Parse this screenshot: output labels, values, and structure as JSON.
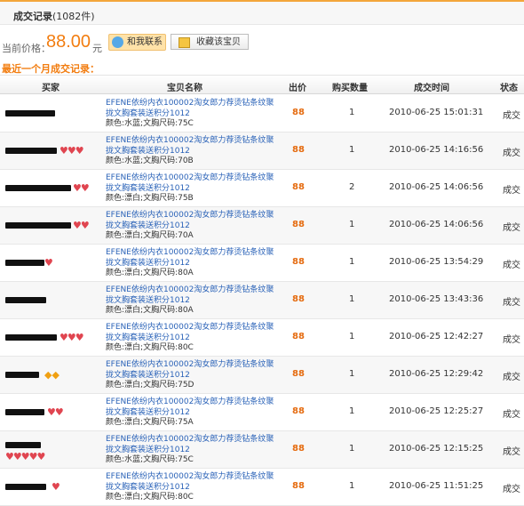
{
  "header": {
    "title": "成交记录",
    "count": "(1082件)"
  },
  "price": {
    "label": "当前价格：",
    "value": "88.00",
    "unit": "元"
  },
  "buttons": {
    "contact": "和我联系",
    "favorite": "收藏该宝贝"
  },
  "recent_title": "最近一个月成交记录：",
  "columns": {
    "buyer": "买家",
    "item": "宝贝名称",
    "price": "出价",
    "qty": "购买数量",
    "time": "成交时间",
    "status": "状态"
  },
  "rows": [
    {
      "title": "EFENE依纷内衣100002淘女郎力荐烫钻条纹聚拢文胸套装送积分1012",
      "attr": "颜色:水蓝;文胸尺码:75C",
      "price": "88",
      "qty": "1",
      "time": "2010-06-25 15:01:31",
      "status": "成交"
    },
    {
      "title": "EFENE依纷内衣100002淘女郎力荐烫钻条纹聚拢文胸套装送积分1012",
      "attr": "颜色:水蓝;文胸尺码:70B",
      "price": "88",
      "qty": "1",
      "time": "2010-06-25 14:16:56",
      "status": "成交"
    },
    {
      "title": "EFENE依纷内衣100002淘女郎力荐烫钻条纹聚拢文胸套装送积分1012",
      "attr": "颜色:漂白;文胸尺码:75B",
      "price": "88",
      "qty": "2",
      "time": "2010-06-25 14:06:56",
      "status": "成交"
    },
    {
      "title": "EFENE依纷内衣100002淘女郎力荐烫钻条纹聚拢文胸套装送积分1012",
      "attr": "颜色:漂白;文胸尺码:70A",
      "price": "88",
      "qty": "1",
      "time": "2010-06-25 14:06:56",
      "status": "成交"
    },
    {
      "title": "EFENE依纷内衣100002淘女郎力荐烫钻条纹聚拢文胸套装送积分1012",
      "attr": "颜色:漂白;文胸尺码:80A",
      "price": "88",
      "qty": "1",
      "time": "2010-06-25 13:54:29",
      "status": "成交"
    },
    {
      "title": "EFENE依纷内衣100002淘女郎力荐烫钻条纹聚拢文胸套装送积分1012",
      "attr": "颜色:漂白;文胸尺码:80A",
      "price": "88",
      "qty": "1",
      "time": "2010-06-25 13:43:36",
      "status": "成交"
    },
    {
      "title": "EFENE依纷内衣100002淘女郎力荐烫钻条纹聚拢文胸套装送积分1012",
      "attr": "颜色:漂白;文胸尺码:80C",
      "price": "88",
      "qty": "1",
      "time": "2010-06-25 12:42:27",
      "status": "成交"
    },
    {
      "title": "EFENE依纷内衣100002淘女郎力荐烫钻条纹聚拢文胸套装送积分1012",
      "attr": "颜色:漂白;文胸尺码:75D",
      "price": "88",
      "qty": "1",
      "time": "2010-06-25 12:29:42",
      "status": "成交"
    },
    {
      "title": "EFENE依纷内衣100002淘女郎力荐烫钻条纹聚拢文胸套装送积分1012",
      "attr": "颜色:漂白;文胸尺码:75A",
      "price": "88",
      "qty": "1",
      "time": "2010-06-25 12:25:27",
      "status": "成交"
    },
    {
      "title": "EFENE依纷内衣100002淘女郎力荐烫钻条纹聚拢文胸套装送积分1012",
      "attr": "颜色:水蓝;文胸尺码:75C",
      "price": "88",
      "qty": "1",
      "time": "2010-06-25 12:15:25",
      "status": "成交"
    },
    {
      "title": "EFENE依纷内衣100002淘女郎力荐烫钻条纹聚拢文胸套装送积分1012",
      "attr": "颜色:漂白;文胸尺码:80C",
      "price": "88",
      "qty": "1",
      "time": "2010-06-25 11:51:25",
      "status": "成交"
    }
  ]
}
